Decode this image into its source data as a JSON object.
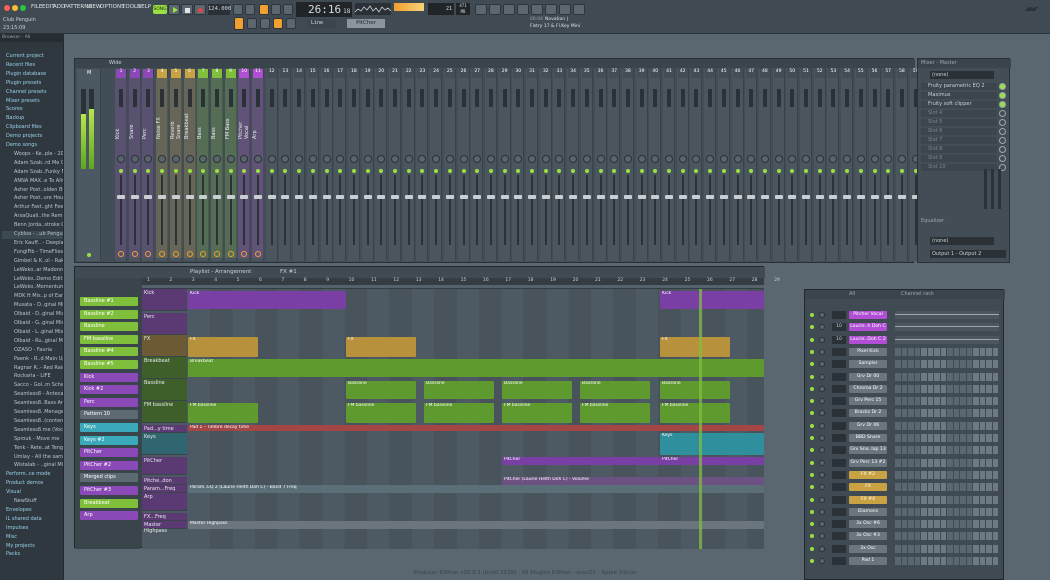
{
  "menu": [
    "FILE",
    "EDIT",
    "ADD",
    "PATTERNS",
    "VIEW",
    "OPTIONS",
    "TOOLS",
    "HELP"
  ],
  "transport": {
    "song_mode": "SONG",
    "tempo": "124.000",
    "time": "26:16",
    "time_sub": "18",
    "pitcher_label": "PitCher",
    "line_label": "Line",
    "hint_time": "06:04",
    "hint_title": "Novation |",
    "hint_sub": "Flstry 17 & Fl.Key Mini",
    "mem": "471 MB",
    "cpu": "21"
  },
  "project": {
    "name": "Club Penguin",
    "time": "23:15:09"
  },
  "browser": {
    "header": "Browser - All",
    "items": [
      {
        "label": "Current project",
        "cat": true
      },
      {
        "label": "Recent files",
        "cat": true
      },
      {
        "label": "Plugin database",
        "cat": true
      },
      {
        "label": "Plugin presets",
        "cat": true
      },
      {
        "label": "Channel presets",
        "cat": true
      },
      {
        "label": "Mixer presets",
        "cat": true
      },
      {
        "label": "Scores",
        "cat": true
      },
      {
        "label": "Backup",
        "cat": true
      },
      {
        "label": "Clipboard files",
        "cat": true
      },
      {
        "label": "Demo projects",
        "cat": true
      },
      {
        "label": "Demo songs",
        "cat": true
      },
      {
        "label": "Woops - Ke..ple - 2015",
        "cat": false
      },
      {
        "label": "Adam Szab..rd Me Out",
        "cat": false
      },
      {
        "label": "Adam Szab..Funky Mix",
        "cat": false
      },
      {
        "label": "ANNA MAX..e To Alive",
        "cat": false
      },
      {
        "label": "Asher Post..olden Bus",
        "cat": false
      },
      {
        "label": "Asher Post..ure House",
        "cat": false
      },
      {
        "label": "Arthur Fast..ght Feeling",
        "cat": false
      },
      {
        "label": "ArxaQuali..the Remix",
        "cat": false
      },
      {
        "label": "Benn Jorda..stroke Cafe",
        "cat": false
      },
      {
        "label": "Cybloa - ..ub Penguin",
        "cat": false
      },
      {
        "label": "Eric Kauff.. - Deeplaner",
        "cat": false
      },
      {
        "label": "FungiFib - TimeFlies",
        "cat": false
      },
      {
        "label": "Gimbel & K..ol - Rakh",
        "cat": false
      },
      {
        "label": "LeWeko..ar Madonna",
        "cat": false
      },
      {
        "label": "LeWeko..Demo Edit)",
        "cat": false
      },
      {
        "label": "LeWeko..Momentum",
        "cat": false
      },
      {
        "label": "MDK ft Mis..p of Earth",
        "cat": false
      },
      {
        "label": "Musata - D..ginal Mix)",
        "cat": false
      },
      {
        "label": "Olbaid - D..ginal Mix)",
        "cat": false
      },
      {
        "label": "Olbaid - G..ginal Mix)",
        "cat": false
      },
      {
        "label": "Olbaid - L..ginal Mix)",
        "cat": false
      },
      {
        "label": "Olbaid - Ru..ginal Mix)",
        "cat": false
      },
      {
        "label": "OZASO - Fauria",
        "cat": false
      },
      {
        "label": "Paenk - R..d Main Up",
        "cat": false
      },
      {
        "label": "Ragnar R..- Red Rain",
        "cat": false
      },
      {
        "label": "Rockaria - LIFE",
        "cat": false
      },
      {
        "label": "Sacco - Gol..m Schett",
        "cat": false
      },
      {
        "label": "Seamless8 - Antecater",
        "cat": false
      },
      {
        "label": "Seamless8..Bass Antes",
        "cat": false
      },
      {
        "label": "Seamless8..Menagerie",
        "cat": false
      },
      {
        "label": "Seamless8..(contential",
        "cat": false
      },
      {
        "label": "Seamless8.me (Vocal)",
        "cat": false
      },
      {
        "label": "Sprouk - Move me",
        "cat": false
      },
      {
        "label": "Tenk - Rete..at Tenge",
        "cat": false
      },
      {
        "label": "Umlay - All the same",
        "cat": false
      },
      {
        "label": "Wistalab - ..ginal Mix)",
        "cat": false
      },
      {
        "label": "Perform..ce mode",
        "cat": true
      },
      {
        "label": "Product demos",
        "cat": true
      },
      {
        "label": "Visual",
        "cat": true
      },
      {
        "label": "NewStuff",
        "cat": false
      },
      {
        "label": "Envelopes",
        "cat": true
      },
      {
        "label": "IL shared data",
        "cat": true
      },
      {
        "label": "Impulses",
        "cat": true
      },
      {
        "label": "Misc",
        "cat": true
      },
      {
        "label": "My projects",
        "cat": true
      },
      {
        "label": "Packs",
        "cat": true
      }
    ]
  },
  "mixer": {
    "title": "Wide",
    "master_label": "M",
    "strips": [
      {
        "num": "1",
        "name": "Kick",
        "color": "#8b49b8"
      },
      {
        "num": "2",
        "name": "Snare",
        "color": "#8b49b8"
      },
      {
        "num": "3",
        "name": "Perc",
        "color": "#8b49b8"
      },
      {
        "num": "4",
        "name": "Noise FX",
        "color": "#c9a244"
      },
      {
        "num": "5",
        "name": "Reverb Snare",
        "color": "#c9a244"
      },
      {
        "num": "6",
        "name": "Breakbeat",
        "color": "#c9a244"
      },
      {
        "num": "7",
        "name": "Bass",
        "color": "#7fbf3c"
      },
      {
        "num": "8",
        "name": "Bass",
        "color": "#7fbf3c"
      },
      {
        "num": "9",
        "name": "FM Bass",
        "color": "#7fbf3c"
      },
      {
        "num": "10",
        "name": "Pitcher Vocal",
        "color": "#b04ed4"
      },
      {
        "num": "11",
        "name": "Arp",
        "color": "#b04ed4"
      },
      {
        "num": "12",
        "name": "",
        "color": ""
      }
    ],
    "empty_count": 48,
    "empty_start": 12
  },
  "fx_panel": {
    "title": "Mixer - Master",
    "input": "(none)",
    "slots": [
      "Fruity parametric EQ 2",
      "Maximus",
      "Fruity soft clipper",
      "Slot 4",
      "Slot 5",
      "Slot 6",
      "Slot 7",
      "Slot 8",
      "Slot 9",
      "Slot 10"
    ],
    "eq_label": "Equalizer",
    "output_none": "(none)",
    "output": "Output 1 - Output 2"
  },
  "playlist": {
    "title": "Playlist - Arrangement",
    "pattern": "FX #1",
    "patterns": [
      {
        "label": "Bassline #1",
        "color": "#7fbf3c"
      },
      {
        "label": "Bassline #2",
        "color": "#7fbf3c"
      },
      {
        "label": "Bassline",
        "color": "#7fbf3c"
      },
      {
        "label": "FM bassline",
        "color": "#7fbf3c"
      },
      {
        "label": "Bassline #4",
        "color": "#7fbf3c"
      },
      {
        "label": "Bassline #5",
        "color": "#7fbf3c"
      },
      {
        "label": "Kick",
        "color": "#8b49b8"
      },
      {
        "label": "Kick #2",
        "color": "#8b49b8"
      },
      {
        "label": "Perc",
        "color": "#8b49b8"
      },
      {
        "label": "Pattern 10",
        "color": "#5e6a72"
      },
      {
        "label": "Keys",
        "color": "#3aa9b9"
      },
      {
        "label": "Keys #2",
        "color": "#3aa9b9"
      },
      {
        "label": "PitCher",
        "color": "#8b49b8"
      },
      {
        "label": "PitCher #2",
        "color": "#8b49b8"
      },
      {
        "label": "Merged clips",
        "color": "#5e6a72"
      },
      {
        "label": "PitCher #3",
        "color": "#8b49b8"
      },
      {
        "label": "Breakbeat",
        "color": "#7fbf3c"
      },
      {
        "label": "Arp",
        "color": "#8b49b8"
      }
    ],
    "tracks": [
      "Kick",
      "Perc",
      "FX",
      "Breakbeat",
      "Bassline",
      "FM bassline",
      "Pad...y time",
      "Keys",
      "PitCher",
      "Pitche..don",
      "Param...Freq",
      "Arp",
      "FX...Freq",
      "Master Highpass"
    ],
    "clip_kick": "Kick",
    "clip_fx": "FX",
    "clip_break": "Breakbeat",
    "clip_bass": "Bassline",
    "clip_fm": "FM bassline",
    "clip_pad": "Pad 1 - Timbre decay time",
    "clip_keys": "Keys",
    "clip_pitcher": "PitCher",
    "clip_pitch_auto": "PitCher (Laurie Helth Doh C) - Volume",
    "clip_param": "Param..EQ 2 (Laurie Helth Doh C) - Band 7 Freq",
    "clip_master": "Master Highpass",
    "bar_numbers": [
      "1",
      "2",
      "3",
      "4",
      "5",
      "6",
      "7",
      "8",
      "9",
      "10",
      "11",
      "12",
      "13",
      "14",
      "15",
      "16",
      "17",
      "18",
      "19",
      "20",
      "21",
      "22",
      "23",
      "24",
      "25",
      "26",
      "27",
      "28",
      "29"
    ]
  },
  "channel_rack": {
    "title": "Channel rack",
    "filter": "All",
    "channels": [
      {
        "num": "",
        "name": "Pitcher Vocal",
        "color": "#b04ed4"
      },
      {
        "num": "10",
        "name": "Laurie..h Doh C",
        "color": "#b04ed4"
      },
      {
        "num": "10",
        "name": "Laurie..Doh C 2",
        "color": "#b04ed4"
      },
      {
        "num": "",
        "name": "Pixel Kick",
        "color": "#6a757d"
      },
      {
        "num": "",
        "name": "Sampler",
        "color": "#6a757d"
      },
      {
        "num": "",
        "name": "Grv Dr 00",
        "color": "#6a757d"
      },
      {
        "num": "",
        "name": "Chroma Dr 2",
        "color": "#6a757d"
      },
      {
        "num": "",
        "name": "Grv Perc 15",
        "color": "#6a757d"
      },
      {
        "num": "",
        "name": "Brackz Dr 2",
        "color": "#6a757d"
      },
      {
        "num": "",
        "name": "Grv Dr 06",
        "color": "#6a757d"
      },
      {
        "num": "",
        "name": "BBD Snare",
        "color": "#6a757d"
      },
      {
        "num": "",
        "name": "Grv Sna..lap 13",
        "color": "#6a757d"
      },
      {
        "num": "",
        "name": "Grv Perc 13 #2",
        "color": "#6a757d"
      },
      {
        "num": "",
        "name": "FX #2",
        "color": "#c9a244"
      },
      {
        "num": "",
        "name": "FX",
        "color": "#c9a244"
      },
      {
        "num": "",
        "name": "FX #4",
        "color": "#c9a244"
      },
      {
        "num": "",
        "name": "Diamons",
        "color": "#6a757d"
      },
      {
        "num": "",
        "name": "3x Osc #6",
        "color": "#6a757d"
      },
      {
        "num": "",
        "name": "3x Osc #3",
        "color": "#6a757d"
      },
      {
        "num": "",
        "name": "3x Osc",
        "color": "#6a757d"
      },
      {
        "num": "",
        "name": "Pad 1",
        "color": "#6a757d"
      }
    ]
  },
  "status_bar": "Producer Edition v20.9.1 [build 2539] - All Plugins Edition - macOS - Apple Silicon",
  "colors": {
    "accent_orange": "#f0a030",
    "accent_green": "#9be042",
    "panel": "#434d55"
  }
}
